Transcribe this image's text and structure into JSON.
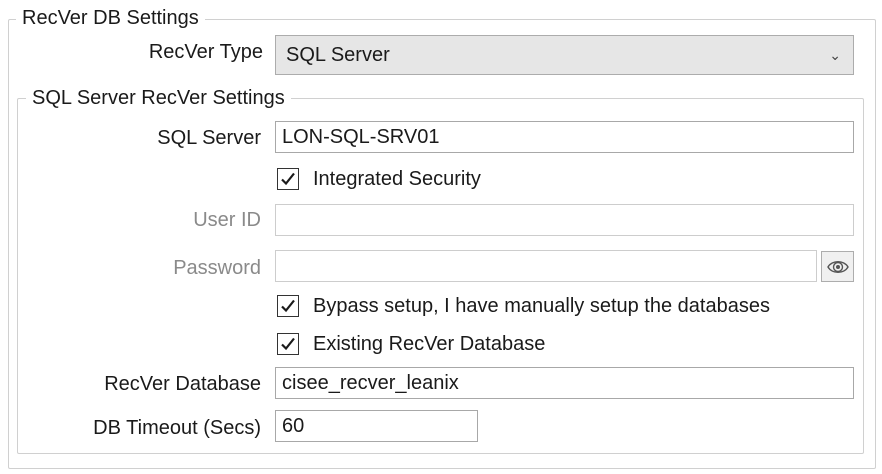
{
  "recver_group": {
    "title": "RecVer DB Settings",
    "type_label": "RecVer Type",
    "type_value": "SQL Server"
  },
  "sql_group": {
    "title": "SQL Server RecVer Settings",
    "server_label": "SQL Server",
    "server_value": "LON-SQL-SRV01",
    "integrated_security_label": "Integrated Security",
    "integrated_security_checked": true,
    "user_id_label": "User ID",
    "user_id_value": "",
    "password_label": "Password",
    "password_value": "",
    "bypass_label": "Bypass setup, I have manually setup the databases",
    "bypass_checked": true,
    "existing_db_label": "Existing RecVer Database",
    "existing_db_checked": true,
    "database_label": "RecVer Database",
    "database_value": "cisee_recver_leanix",
    "timeout_label": "DB Timeout (Secs)",
    "timeout_value": "60"
  },
  "icons": {
    "dropdown": "chevron-down-icon",
    "show_password": "eye-icon",
    "check": "checkmark-icon"
  }
}
